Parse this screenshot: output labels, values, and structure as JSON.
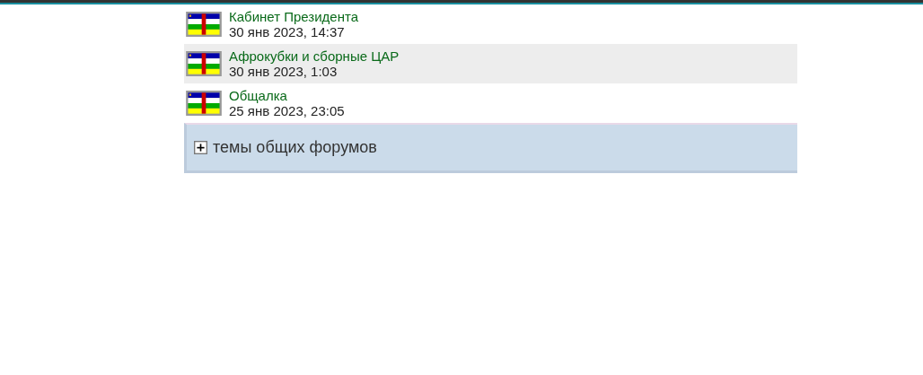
{
  "forums": [
    {
      "title": "Кабинет Президента",
      "date": "30 янв 2023, 14:37",
      "highlighted": false
    },
    {
      "title": "Афрокубки и сборные ЦАР",
      "date": "30 янв 2023, 1:03",
      "highlighted": true
    },
    {
      "title": "Общалка",
      "date": "25 янв 2023, 23:05",
      "highlighted": false
    }
  ],
  "section": {
    "label": "темы общих форумов",
    "expanded": false
  }
}
